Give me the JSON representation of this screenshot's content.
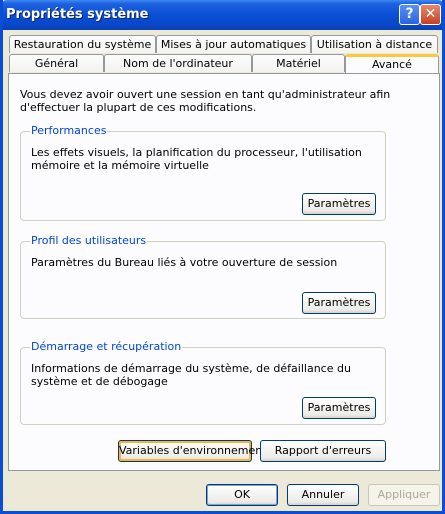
{
  "window": {
    "title": "Propriétés système",
    "help": "?",
    "close": "✕"
  },
  "tabs_row1": [
    "Restauration du système",
    "Mises à jour automatiques",
    "Utilisation à distance"
  ],
  "tabs_row2": [
    "Général",
    "Nom de l'ordinateur",
    "Matériel",
    "Avancé"
  ],
  "active_tab": "Avancé",
  "intro": "Vous devez avoir ouvert une session en tant qu'administrateur afin d'effectuer la plupart de ces modifications.",
  "performances": {
    "legend": "Performances",
    "text": "Les effets visuels, la planification du processeur, l'utilisation mémoire et la mémoire virtuelle",
    "button": "Paramètres"
  },
  "profil": {
    "legend": "Profil des utilisateurs",
    "text": "Paramètres du Bureau liés à votre ouverture de session",
    "button": "Paramètres"
  },
  "demarrage": {
    "legend": "Démarrage et récupération",
    "text": "Informations de démarrage du système, de défaillance du système et de débogage",
    "button": "Paramètres"
  },
  "env_button": "Variables d'environnement",
  "report_button": "Rapport d'erreurs",
  "footer": {
    "ok": "OK",
    "cancel": "Annuler",
    "apply": "Appliquer"
  }
}
